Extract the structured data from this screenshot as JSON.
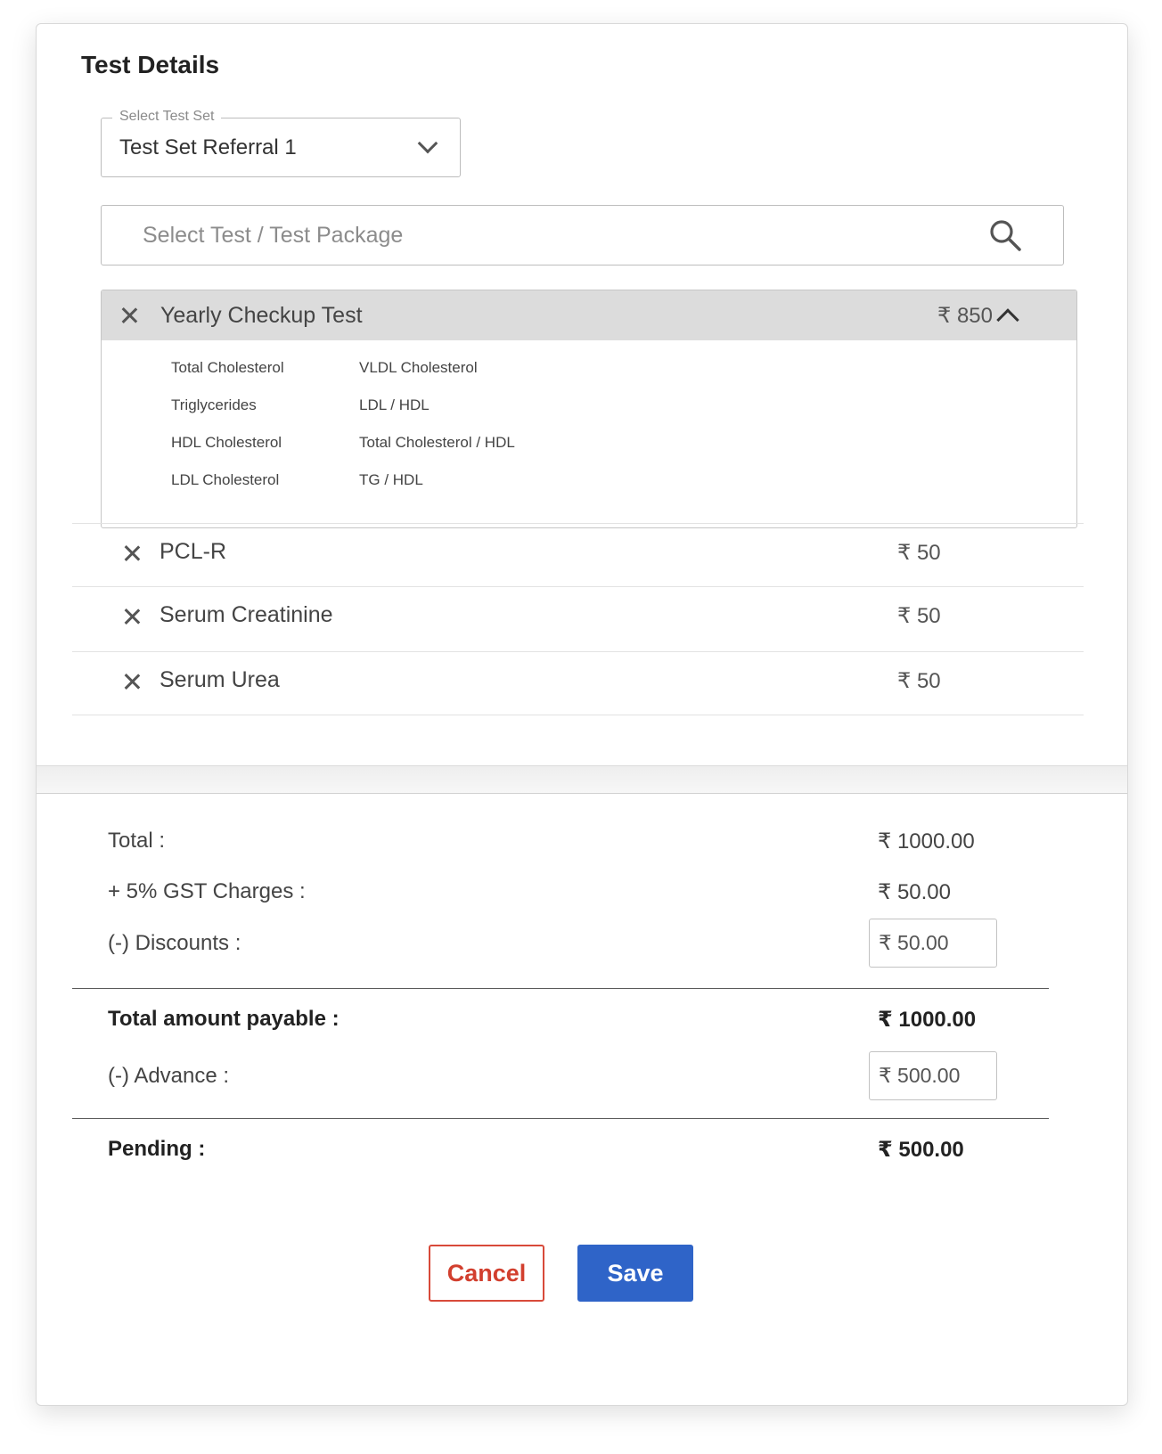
{
  "test_details": {
    "title": "Test Details",
    "test_set_select": {
      "legend": "Select Test Set",
      "value": "Test Set Referral 1"
    },
    "search": {
      "placeholder": "Select Test / Test Package",
      "icon": "search-icon"
    },
    "package": {
      "name": "Yearly Checkup Test",
      "price": "₹ 850",
      "expanded": true,
      "items_col1": [
        "Total Cholesterol",
        "Triglycerides",
        "HDL Cholesterol",
        "LDL Cholesterol"
      ],
      "items_col2": [
        "VLDL Cholesterol",
        "LDL / HDL",
        "Total Cholesterol / HDL",
        "TG / HDL"
      ]
    },
    "tests": [
      {
        "name": "PCL-R",
        "price": "₹ 50"
      },
      {
        "name": "Serum Creatinine",
        "price": "₹ 50"
      },
      {
        "name": "Serum Urea",
        "price": "₹ 50"
      }
    ]
  },
  "summary": {
    "total_label": "Total :",
    "total_value": "₹ 1000.00",
    "gst_label": "+ 5% GST Charges :",
    "gst_value": "₹ 50.00",
    "discount_label": "(-) Discounts :",
    "discount_value": "₹ 50.00",
    "payable_label": "Total amount payable :",
    "payable_value": "₹ 1000.00",
    "advance_label": "(-) Advance :",
    "advance_value": "₹ 500.00",
    "pending_label": "Pending :",
    "pending_value": "₹ 500.00"
  },
  "actions": {
    "cancel_label": "Cancel",
    "save_label": "Save"
  },
  "colors": {
    "save": "#2f64c8",
    "cancel": "#d23f2e",
    "package_header": "#dcdcdc"
  }
}
